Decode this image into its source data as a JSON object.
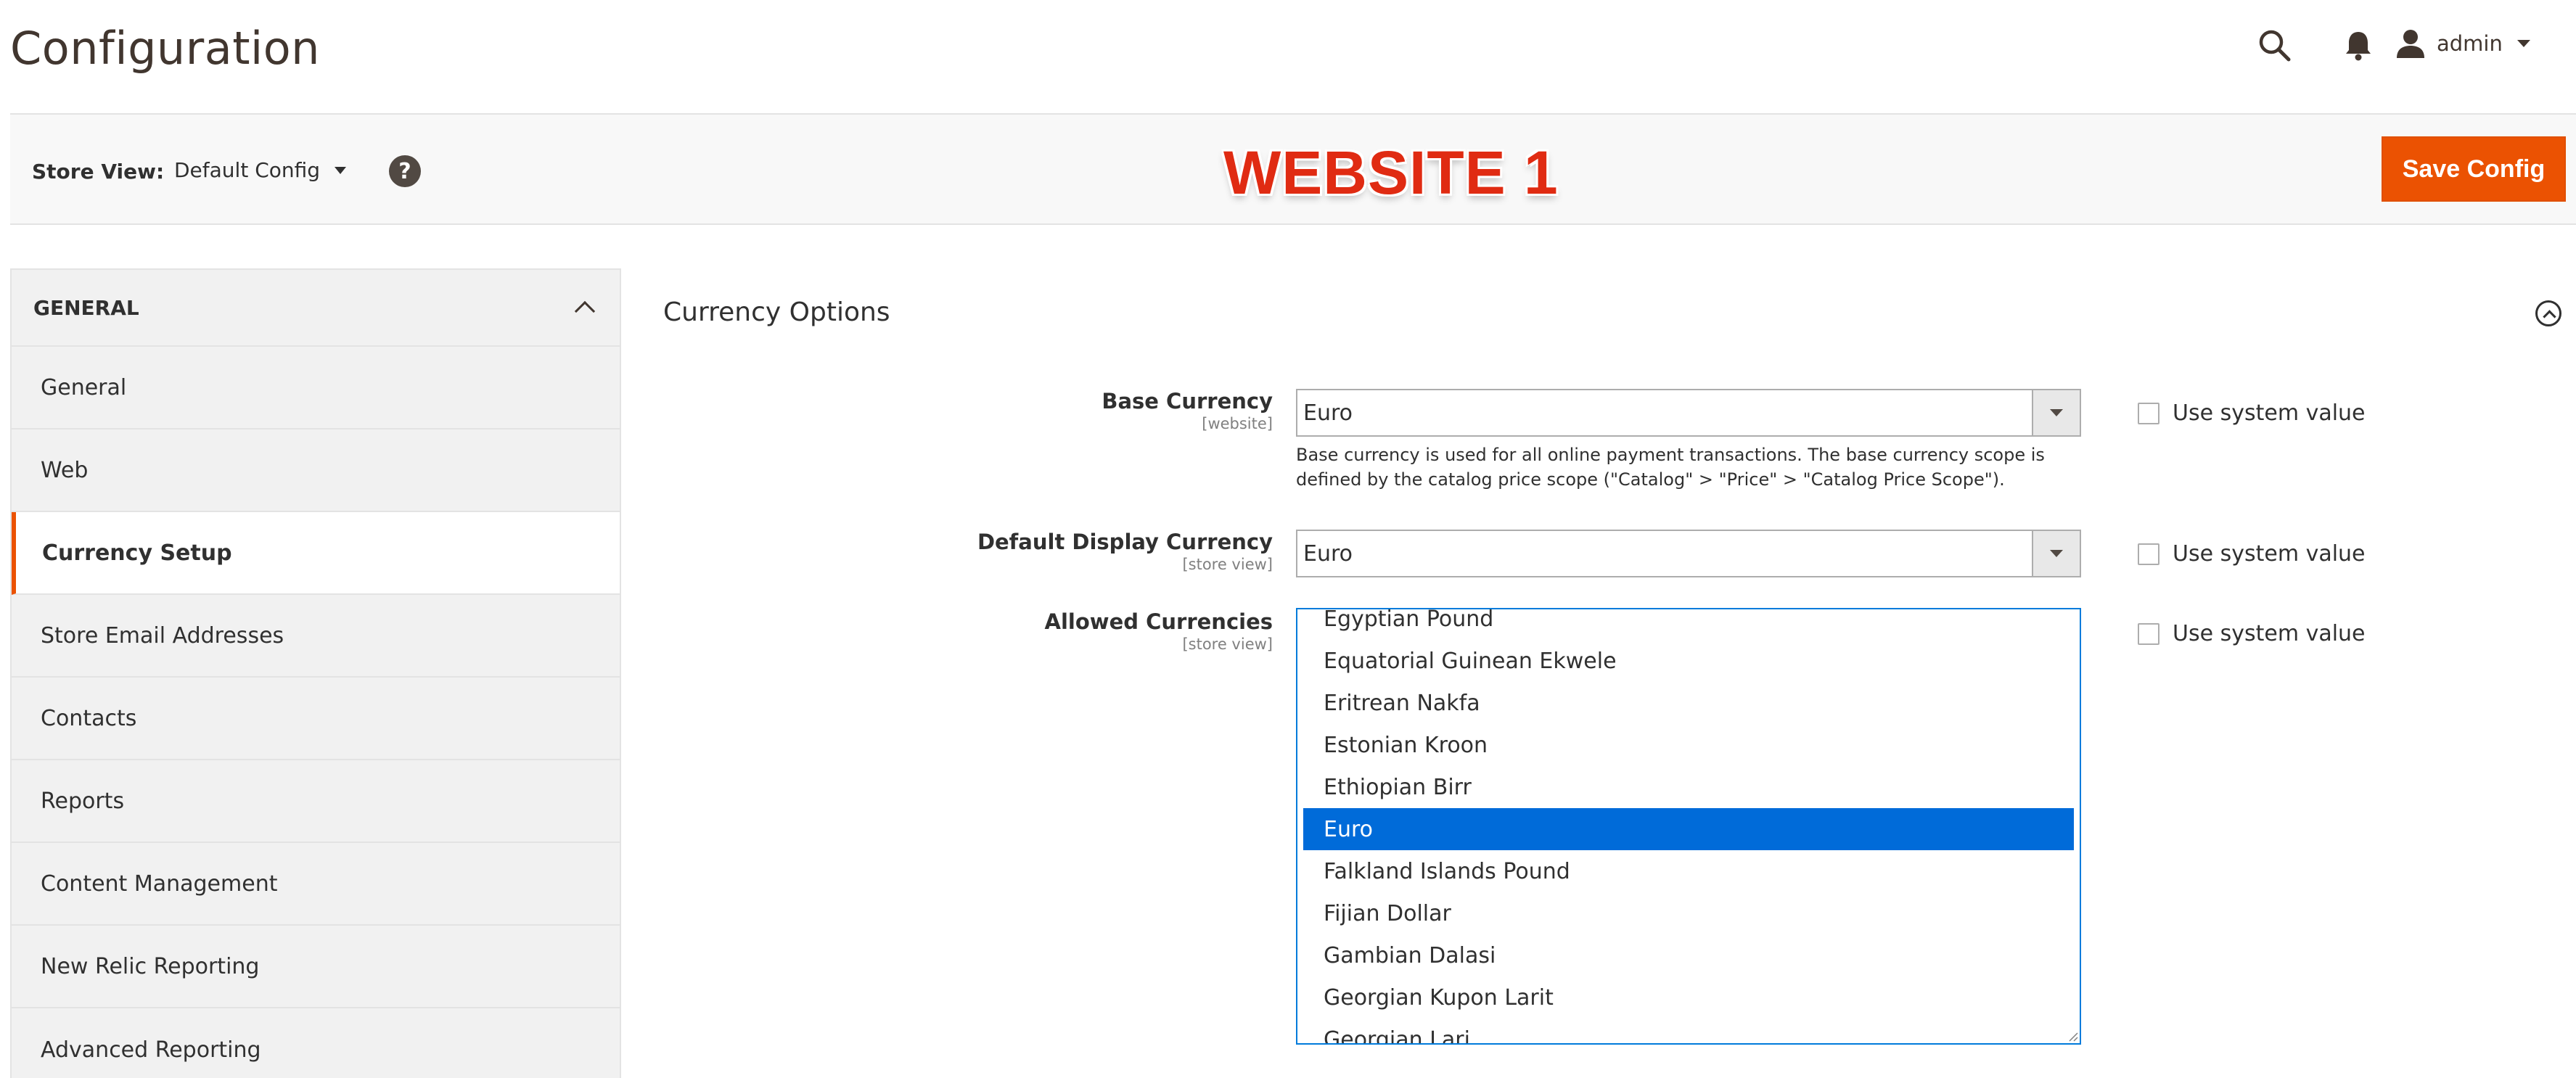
{
  "header": {
    "title": "Configuration",
    "user": "admin"
  },
  "store_bar": {
    "label": "Store View:",
    "selected": "Default Config",
    "help": "?",
    "banner": "WEBSITE 1",
    "save_label": "Save Config"
  },
  "sidebar": {
    "section": "GENERAL",
    "items": [
      {
        "label": "General"
      },
      {
        "label": "Web"
      },
      {
        "label": "Currency Setup"
      },
      {
        "label": "Store Email Addresses"
      },
      {
        "label": "Contacts"
      },
      {
        "label": "Reports"
      },
      {
        "label": "Content Management"
      },
      {
        "label": "New Relic Reporting"
      },
      {
        "label": "Advanced Reporting"
      }
    ]
  },
  "main": {
    "section_title": "Currency Options",
    "use_system_value": "Use system value",
    "base_currency": {
      "label": "Base Currency",
      "scope": "[website]",
      "value": "Euro",
      "note": "Base currency is used for all online payment transactions. The base currency scope is defined by the catalog price scope (\"Catalog\" > \"Price\" > \"Catalog Price Scope\")."
    },
    "display_currency": {
      "label": "Default Display Currency",
      "scope": "[store view]",
      "value": "Euro"
    },
    "allowed_currencies": {
      "label": "Allowed Currencies",
      "scope": "[store view]",
      "options": [
        "Egyptian Pound",
        "Equatorial Guinean Ekwele",
        "Eritrean Nakfa",
        "Estonian Kroon",
        "Ethiopian Birr",
        "Euro",
        "Falkland Islands Pound",
        "Fijian Dollar",
        "Gambian Dalasi",
        "Georgian Kupon Larit",
        "Georgian Lari"
      ],
      "selected": "Euro"
    }
  },
  "colors": {
    "accent": "#eb5202",
    "selected": "#006bd9",
    "banner": "#e02b12"
  }
}
